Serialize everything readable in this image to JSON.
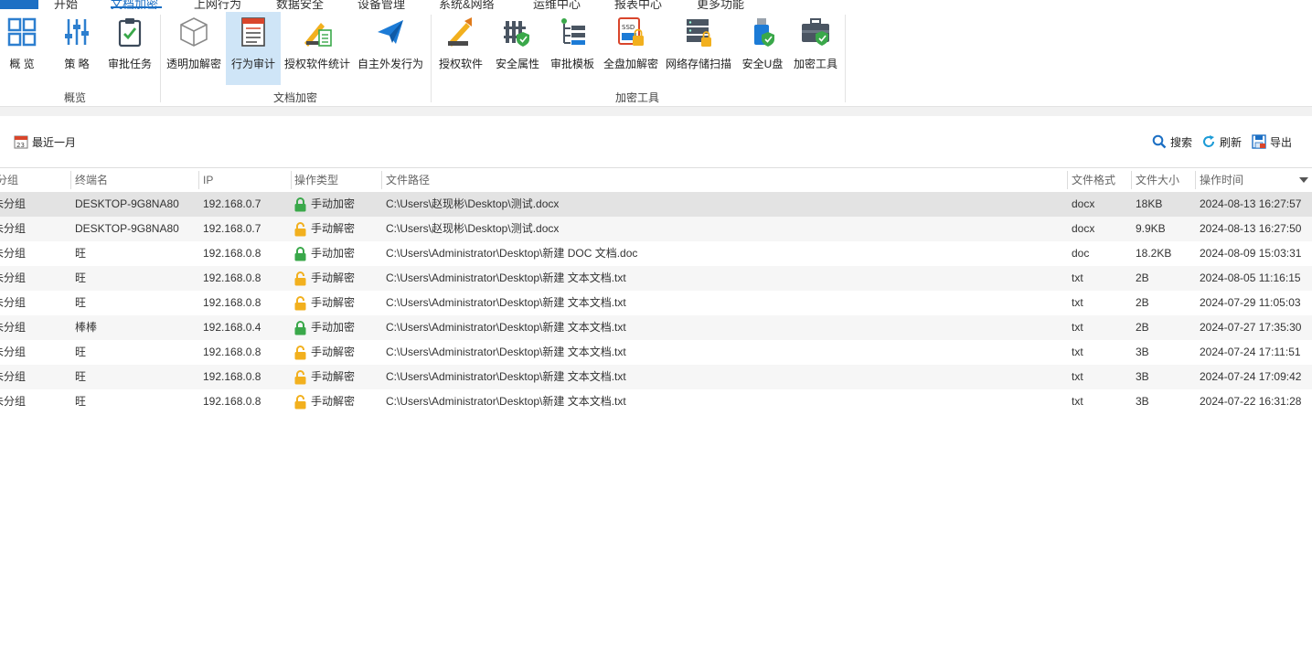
{
  "top_tabs": [
    {
      "label": "开始"
    },
    {
      "label": "文档加密"
    },
    {
      "label": "上网行为"
    },
    {
      "label": "数据安全"
    },
    {
      "label": "设备管理"
    },
    {
      "label": "系统&网络"
    },
    {
      "label": "运维中心"
    },
    {
      "label": "报表中心"
    },
    {
      "label": "更多功能"
    }
  ],
  "ribbon": {
    "groups": [
      {
        "label": "概览",
        "buttons": [
          {
            "label": "概 览",
            "icon": "overview-grid-icon"
          },
          {
            "label": "策 略",
            "icon": "policy-sliders-icon"
          },
          {
            "label": "审批任务",
            "icon": "approval-clipboard-icon"
          }
        ]
      },
      {
        "label": "文档加密",
        "buttons": [
          {
            "label": "透明加解密",
            "icon": "transparent-cube-icon"
          },
          {
            "label": "行为审计",
            "icon": "audit-document-icon",
            "active": true
          },
          {
            "label": "授权软件统计",
            "icon": "software-stats-icon"
          },
          {
            "label": "自主外发行为",
            "icon": "paper-plane-icon"
          }
        ]
      },
      {
        "label": "加密工具",
        "buttons": [
          {
            "label": "授权软件",
            "icon": "authorize-software-icon"
          },
          {
            "label": "安全属性",
            "icon": "security-attribute-icon"
          },
          {
            "label": "审批模板",
            "icon": "approval-template-icon"
          },
          {
            "label": "全盘加解密",
            "icon": "ssd-lock-icon"
          },
          {
            "label": "网络存储扫描",
            "icon": "network-storage-icon"
          },
          {
            "label": "安全U盘",
            "icon": "secure-usb-icon"
          },
          {
            "label": "加密工具",
            "icon": "encryption-toolbox-icon"
          }
        ]
      }
    ]
  },
  "toolbar": {
    "date_filter": "最近一月",
    "search": "搜索",
    "refresh": "刷新",
    "export": "导出"
  },
  "table": {
    "columns": [
      "分组",
      "终端名",
      "IP",
      "操作类型",
      "文件路径",
      "文件格式",
      "文件大小",
      "操作时间"
    ],
    "rows": [
      {
        "group": "未分组",
        "terminal": "DESKTOP-9G8NA80",
        "ip": "192.168.0.7",
        "op": "手动加密",
        "op_kind": "encrypt",
        "path": "C:\\Users\\赵现彬\\Desktop\\测试.docx",
        "fmt": "docx",
        "size": "18KB",
        "time": "2024-08-13 16:27:57"
      },
      {
        "group": "未分组",
        "terminal": "DESKTOP-9G8NA80",
        "ip": "192.168.0.7",
        "op": "手动解密",
        "op_kind": "decrypt",
        "path": "C:\\Users\\赵现彬\\Desktop\\测试.docx",
        "fmt": "docx",
        "size": "9.9KB",
        "time": "2024-08-13 16:27:50"
      },
      {
        "group": "未分组",
        "terminal": "旺",
        "ip": "192.168.0.8",
        "op": "手动加密",
        "op_kind": "encrypt",
        "path": "C:\\Users\\Administrator\\Desktop\\新建 DOC 文档.doc",
        "fmt": "doc",
        "size": "18.2KB",
        "time": "2024-08-09 15:03:31"
      },
      {
        "group": "未分组",
        "terminal": "旺",
        "ip": "192.168.0.8",
        "op": "手动解密",
        "op_kind": "decrypt",
        "path": "C:\\Users\\Administrator\\Desktop\\新建 文本文档.txt",
        "fmt": "txt",
        "size": "2B",
        "time": "2024-08-05 11:16:15"
      },
      {
        "group": "未分组",
        "terminal": "旺",
        "ip": "192.168.0.8",
        "op": "手动解密",
        "op_kind": "decrypt",
        "path": "C:\\Users\\Administrator\\Desktop\\新建 文本文档.txt",
        "fmt": "txt",
        "size": "2B",
        "time": "2024-07-29 11:05:03"
      },
      {
        "group": "未分组",
        "terminal": "棒棒",
        "ip": "192.168.0.4",
        "op": "手动加密",
        "op_kind": "encrypt",
        "path": "C:\\Users\\Administrator\\Desktop\\新建 文本文档.txt",
        "fmt": "txt",
        "size": "2B",
        "time": "2024-07-27 17:35:30"
      },
      {
        "group": "未分组",
        "terminal": "旺",
        "ip": "192.168.0.8",
        "op": "手动解密",
        "op_kind": "decrypt",
        "path": "C:\\Users\\Administrator\\Desktop\\新建 文本文档.txt",
        "fmt": "txt",
        "size": "3B",
        "time": "2024-07-24 17:11:51"
      },
      {
        "group": "未分组",
        "terminal": "旺",
        "ip": "192.168.0.8",
        "op": "手动解密",
        "op_kind": "decrypt",
        "path": "C:\\Users\\Administrator\\Desktop\\新建 文本文档.txt",
        "fmt": "txt",
        "size": "3B",
        "time": "2024-07-24 17:09:42"
      },
      {
        "group": "未分组",
        "terminal": "旺",
        "ip": "192.168.0.8",
        "op": "手动解密",
        "op_kind": "decrypt",
        "path": "C:\\Users\\Administrator\\Desktop\\新建 文本文档.txt",
        "fmt": "txt",
        "size": "3B",
        "time": "2024-07-22 16:31:28"
      }
    ]
  },
  "colors": {
    "accent": "#1c6fc4",
    "encrypt_lock": "#3aa84a",
    "decrypt_lock": "#f2b01e",
    "selected_row": "#e3e3e3",
    "active_button": "#cfe5f7"
  }
}
